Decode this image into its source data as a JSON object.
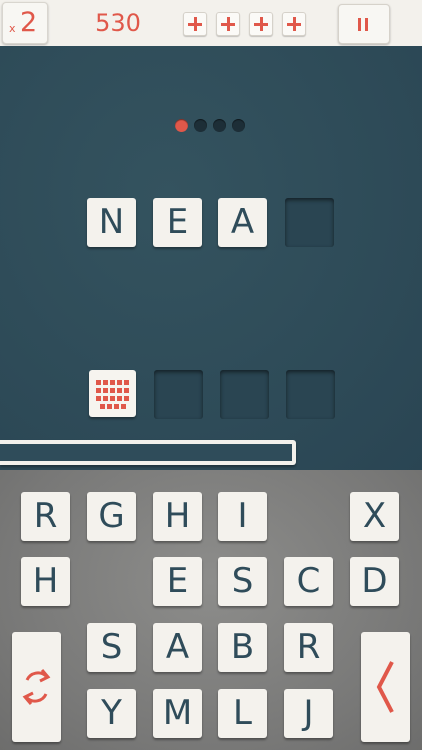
{
  "header": {
    "multiplier_prefix": "x",
    "multiplier_value": "2",
    "score": "530",
    "boosters": [
      "plus-icon",
      "plus-icon",
      "plus-icon",
      "plus-icon"
    ],
    "pause_icon": "pause-icon"
  },
  "level_progress": {
    "total": 4,
    "current": 1
  },
  "word": {
    "letters": [
      "N",
      "E",
      "A",
      ""
    ]
  },
  "bonus_row": {
    "toggle_icon": "keyboard-icon",
    "slots": 3
  },
  "timer_progress": 0.0,
  "keyboard": {
    "rows": [
      [
        "R",
        "G",
        "H",
        "I",
        "",
        "X"
      ],
      [
        "H",
        "",
        "E",
        "S",
        "C",
        "D"
      ],
      [
        "",
        "S",
        "A",
        "B",
        "R",
        ""
      ],
      [
        "",
        "Y",
        "M",
        "L",
        "J",
        ""
      ]
    ],
    "shuffle_icon": "shuffle-icon",
    "back_icon": "chevron-left-icon"
  },
  "colors": {
    "accent": "#e0584a",
    "board": "#2f4c5a",
    "tile": "#f4f2ed",
    "keyboard_bg": "#7f7f7e"
  }
}
